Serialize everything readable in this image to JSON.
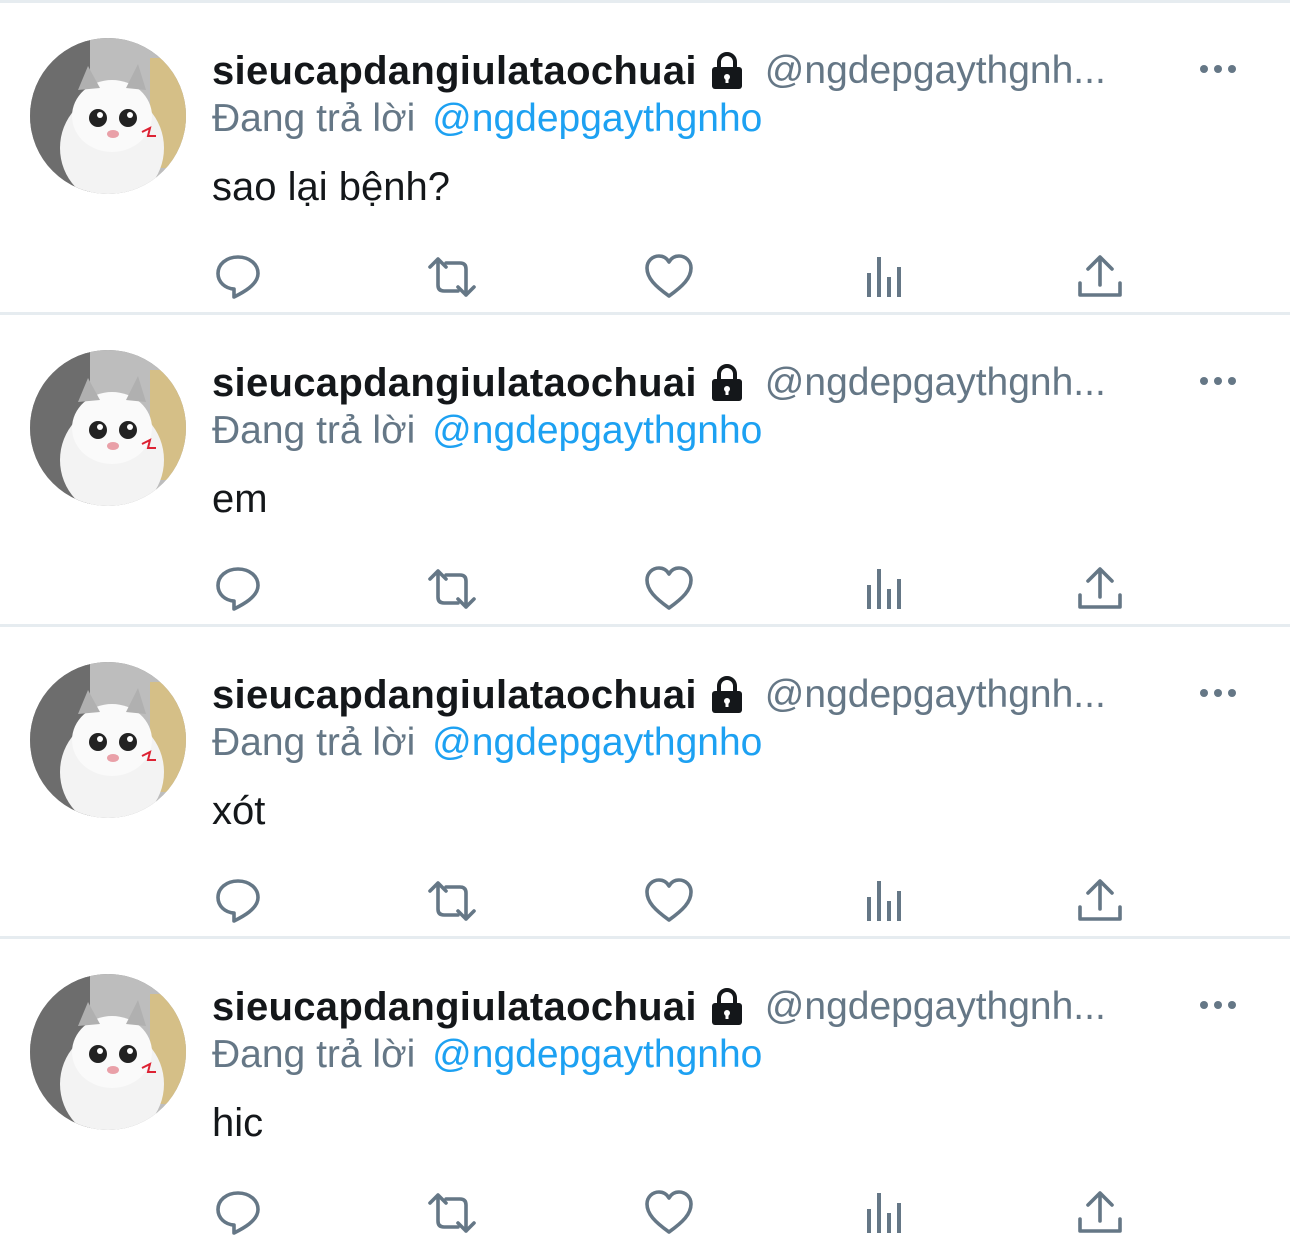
{
  "colors": {
    "text_primary": "#14171a",
    "text_secondary": "#657786",
    "link": "#1da1f2",
    "icon": "#657786",
    "divider": "#e6ecf0"
  },
  "tweets": [
    {
      "display_name": "sieucapdangiulataochuai",
      "handle": "@ngdepgaythgnh...",
      "reply_prefix": "Đang trả lời",
      "reply_to": "@ngdepgaythgnho",
      "text": "sao lại bệnh?"
    },
    {
      "display_name": "sieucapdangiulataochuai",
      "handle": "@ngdepgaythgnh...",
      "reply_prefix": "Đang trả lời",
      "reply_to": "@ngdepgaythgnho",
      "text": "em"
    },
    {
      "display_name": "sieucapdangiulataochuai",
      "handle": "@ngdepgaythgnh...",
      "reply_prefix": "Đang trả lời",
      "reply_to": "@ngdepgaythgnho",
      "text": "xót"
    },
    {
      "display_name": "sieucapdangiulataochuai",
      "handle": "@ngdepgaythgnh...",
      "reply_prefix": "Đang trả lời",
      "reply_to": "@ngdepgaythgnho",
      "text": "hic"
    }
  ],
  "icons": {
    "lock": "lock-icon",
    "more": "more-icon",
    "reply": "reply-icon",
    "retweet": "retweet-icon",
    "like": "heart-icon",
    "analytics": "analytics-icon",
    "share": "share-icon"
  }
}
